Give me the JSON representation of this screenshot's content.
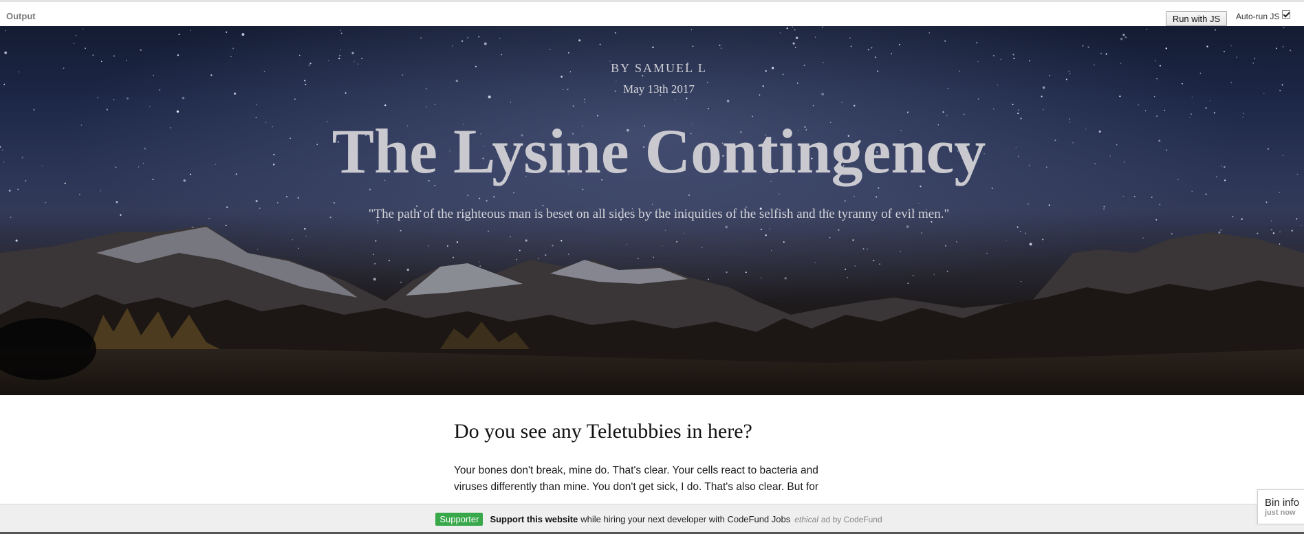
{
  "output_bar": {
    "label": "Output",
    "run_button_label": "Run with JS",
    "autorun_label": "Auto-run JS",
    "autorun_checked": true
  },
  "hero": {
    "byline": "BY SAMUEL L",
    "date": "May 13th 2017",
    "title": "The Lysine Contingency",
    "quote": "\"The path of the righteous man is beset on all sides by the iniquities of the selfish and the tyranny of evil men.\""
  },
  "article": {
    "heading": "Do you see any Teletubbies in here?",
    "body": "Your bones don't break, mine do. That's clear. Your cells react to bacteria and viruses differently than mine. You don't get sick, I do. That's also clear. But for"
  },
  "ad_bar": {
    "badge": "Supporter",
    "strong": "Support this website",
    "text": "while hiring your next developer with CodeFund Jobs",
    "ethical": "ethical",
    "by": "ad by CodeFund"
  },
  "bin_info": {
    "title": "Bin info",
    "subtitle": "just now"
  },
  "colors": {
    "supporter_green": "#38a84a",
    "hero_title": "#c9c9cf"
  }
}
